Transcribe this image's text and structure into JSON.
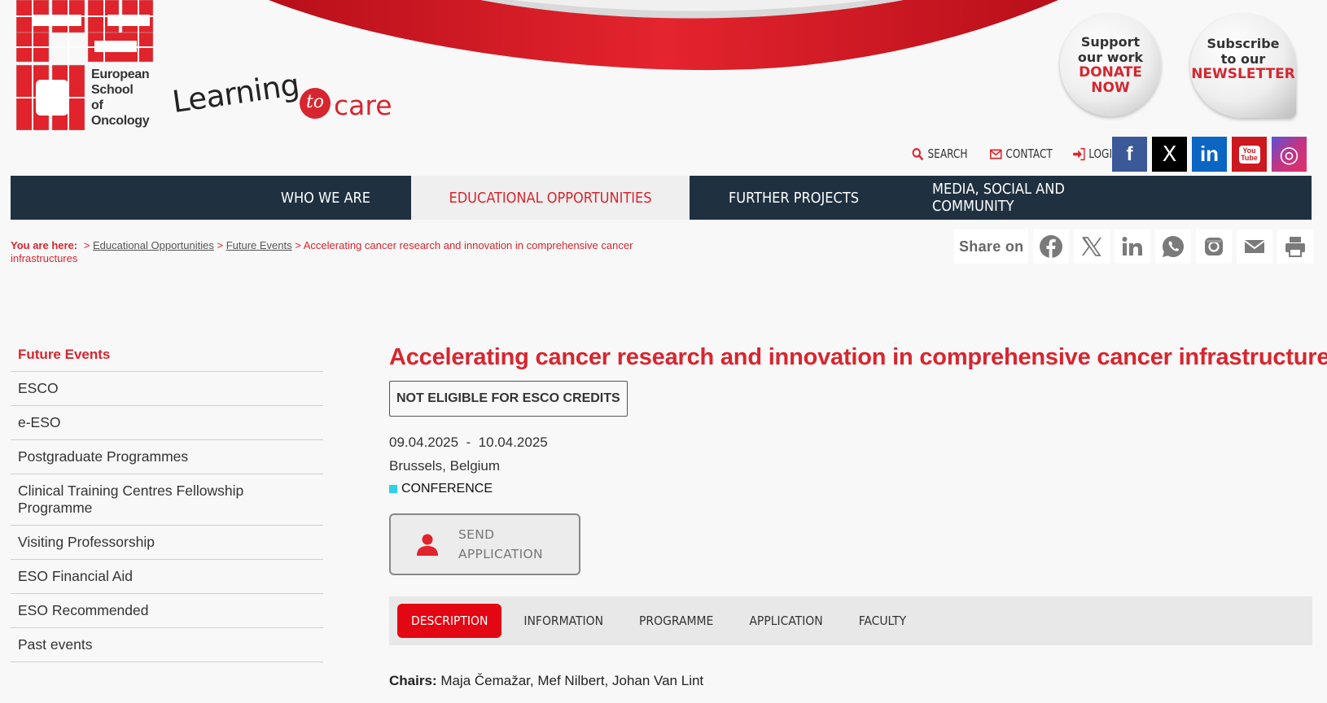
{
  "brand": {
    "logo_text": [
      "European",
      "School",
      "of",
      "Oncology"
    ],
    "tagline_learning": "Learning",
    "tagline_to": "to",
    "tagline_care": "care",
    "red": "#d7262f",
    "navy": "#1f3040"
  },
  "donate": {
    "line1": "Support",
    "line2": "our work",
    "line3": "DONATE",
    "line4": "NOW"
  },
  "newsletter": {
    "line1": "Subscribe",
    "line2": "to our",
    "line3": "NEWSLETTER"
  },
  "toplinks": {
    "search": "SEARCH",
    "contact": "CONTACT",
    "login": "LOGIN"
  },
  "socials": [
    {
      "name": "facebook",
      "glyph": "f",
      "color": "#3b5998"
    },
    {
      "name": "x",
      "glyph": "X",
      "color": "#000000"
    },
    {
      "name": "linkedin",
      "glyph": "in",
      "color": "#0a66c2"
    },
    {
      "name": "youtube",
      "glyph": "You Tube",
      "color": "#cc181e"
    },
    {
      "name": "instagram",
      "glyph": "◎",
      "color": "#a43cad"
    }
  ],
  "nav": [
    "WHO WE ARE",
    "EDUCATIONAL OPPORTUNITIES",
    "FURTHER PROJECTS",
    "MEDIA, SOCIAL AND COMMUNITY"
  ],
  "breadcrumb": {
    "here": "You are here:",
    "sep": ">",
    "item1": "Educational Opportunities",
    "item2": "Future Events",
    "current": "Accelerating cancer research and innovation in comprehensive cancer infrastructures"
  },
  "share": {
    "label": "Share on"
  },
  "sidebar": [
    "Future Events",
    "ESCO",
    "e-ESO",
    "Postgraduate Programmes",
    "Clinical Training Centres Fellowship Programme",
    "Visiting Professorship",
    "ESO Financial Aid",
    "ESO Recommended",
    "Past events"
  ],
  "event": {
    "title": "Accelerating cancer research and innovation in comprehensive cancer infrastructures",
    "credits": "NOT ELIGIBLE FOR ESCO CREDITS",
    "date_start": "09.04.2025",
    "date_sep": "-",
    "date_end": "10.04.2025",
    "place": "Brussels, Belgium",
    "type": "CONFERENCE",
    "type_color": "#2cd2e6",
    "send_line1": "SEND",
    "send_line2": "APPLICATION"
  },
  "tabs": [
    "DESCRIPTION",
    "INFORMATION",
    "PROGRAMME",
    "APPLICATION",
    "FACULTY"
  ],
  "chairs": {
    "label": "Chairs:",
    "names": "Maja Čemažar, Mef Nilbert, Johan Van Lint"
  }
}
